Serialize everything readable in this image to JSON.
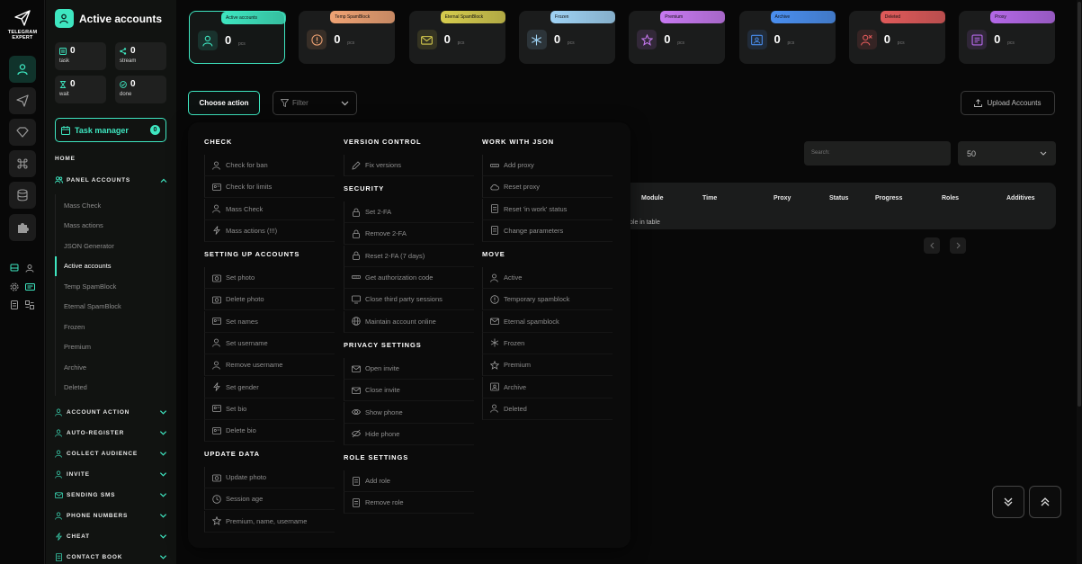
{
  "app": {
    "brand_line1": "TELEGRAM",
    "brand_line2": "EXPERT"
  },
  "sidebar": {
    "title": "Active accounts",
    "stats": [
      {
        "value": "0",
        "label": "task"
      },
      {
        "value": "0",
        "label": "stream"
      },
      {
        "value": "0",
        "label": "wait"
      },
      {
        "value": "0",
        "label": "done"
      }
    ],
    "task_manager": {
      "label": "Task manager",
      "count": "0"
    },
    "home": "HOME",
    "panel_accounts": "PANEL ACCOUNTS",
    "sub_items": [
      "Mass Check",
      "Mass actions",
      "JSON Generator",
      "Active accounts",
      "Temp SpamBlock",
      "Eternal SpamBlock",
      "Frozen",
      "Premium",
      "Archive",
      "Deleted"
    ],
    "sections": [
      "ACCOUNT ACTION",
      "AUTO-REGISTER",
      "COLLECT AUDIENCE",
      "INVITE",
      "SENDING SMS",
      "PHONE NUMBERS",
      "CHEAT",
      "CONTACT BOOK"
    ]
  },
  "cards": [
    {
      "label": "Active accounts",
      "value": "0",
      "unit": "pcs",
      "color": "#3ee6c0",
      "icon": "user-check-icon"
    },
    {
      "label": "Temp SpamBlock",
      "value": "0",
      "unit": "pcs",
      "color": "#f0a374",
      "icon": "alert-circle-icon"
    },
    {
      "label": "Eternal SpamBlock",
      "value": "0",
      "unit": "pcs",
      "color": "#d6cc4e",
      "icon": "mail-block-icon"
    },
    {
      "label": "Frozen",
      "value": "0",
      "unit": "pcs",
      "color": "#9fd3f5",
      "icon": "snowflake-icon"
    },
    {
      "label": "Premium",
      "value": "0",
      "unit": "pcs",
      "color": "#c879f2",
      "icon": "star-icon"
    },
    {
      "label": "Archive",
      "value": "0",
      "unit": "pcs",
      "color": "#4a8ff0",
      "icon": "archive-icon"
    },
    {
      "label": "Deleted",
      "value": "0",
      "unit": "pcs",
      "color": "#e05a5a",
      "icon": "user-x-icon"
    },
    {
      "label": "Proxy",
      "value": "0",
      "unit": "pcs",
      "color": "#b468e8",
      "icon": "proxy-icon"
    }
  ],
  "toolbar": {
    "choose_action": "Choose action",
    "filter": "Filter",
    "upload": "Upload Accounts",
    "search_placeholder": "Search:",
    "page_size": "50"
  },
  "table": {
    "columns": [
      "Module",
      "Time",
      "Proxy",
      "Status",
      "Progress",
      "Roles",
      "Additives"
    ],
    "empty_text": "ble in table"
  },
  "menu": {
    "check": {
      "title": "CHECK",
      "items": [
        "Check for ban",
        "Check for limits",
        "Mass Check",
        "Mass actions (!!!)"
      ]
    },
    "setup": {
      "title": "SETTING UP ACCOUNTS",
      "items": [
        "Set photo",
        "Delete photo",
        "Set names",
        "Set username",
        "Remove username",
        "Set gender",
        "Set bio",
        "Delete bio"
      ]
    },
    "update": {
      "title": "UPDATE DATA",
      "items": [
        "Update photo",
        "Session age",
        "Premium, name, username"
      ]
    },
    "version": {
      "title": "VERSION CONTROL",
      "items": [
        "Fix versions"
      ]
    },
    "security": {
      "title": "SECURITY",
      "items": [
        "Set 2-FA",
        "Remove 2-FA",
        "Reset 2-FA (7 days)",
        "Get authorization code",
        "Close third party sessions",
        "Maintain account online"
      ]
    },
    "privacy": {
      "title": "PRIVACY SETTINGS",
      "items": [
        "Open invite",
        "Close invite",
        "Show phone",
        "Hide phone"
      ]
    },
    "role": {
      "title": "ROLE SETTINGS",
      "items": [
        "Add role",
        "Remove role"
      ]
    },
    "json": {
      "title": "WORK WITH JSON",
      "items": [
        "Add proxy",
        "Reset proxy",
        "Reset 'in work' status",
        "Change parameters"
      ]
    },
    "move": {
      "title": "MOVE",
      "items": [
        "Active",
        "Temporary spamblock",
        "Eternal spamblock",
        "Frozen",
        "Premium",
        "Archive",
        "Deleted"
      ]
    }
  }
}
